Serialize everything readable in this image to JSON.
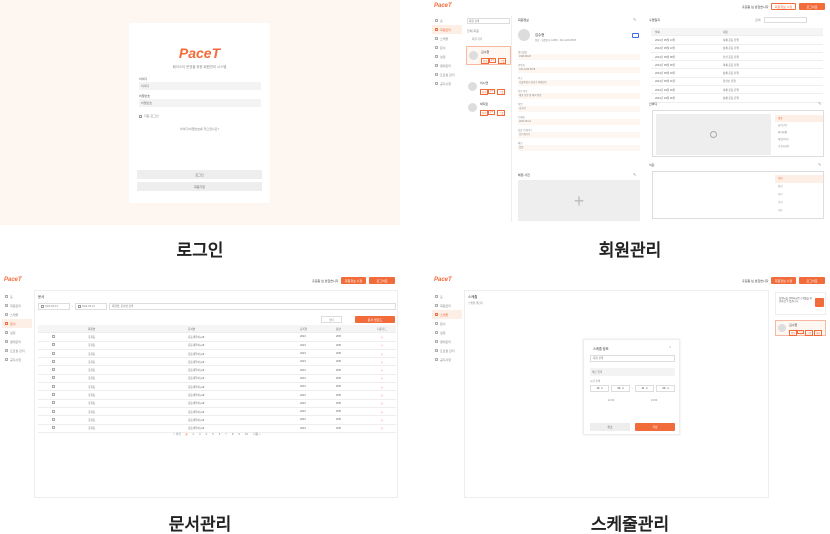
{
  "captions": {
    "login": "로그인",
    "member": "회원관리",
    "document": "문서관리",
    "schedule": "스케줄관리"
  },
  "brand": "PaceT",
  "colors": {
    "accent": "#f26b3a",
    "login_bg": "#fdf6f1",
    "field_bg": "#f3f3f3"
  },
  "login": {
    "subtitle": "페이스티 운영을 위한 회원관리 시스템",
    "id_label": "아이디",
    "id_placeholder": "아이디",
    "pw_label": "비밀번호",
    "pw_placeholder": "비밀번호",
    "remember_label": "자동 로그인",
    "find_link": "아이디/비밀번호를 잊으셨나요?",
    "login_button": "로그인",
    "signup_button": "회원가입"
  },
  "header": {
    "user_label": "홍길동 님 반갑습니다",
    "mypage_button": "회원정보 수정",
    "logout_button": "로그아웃"
  },
  "sidebar": {
    "items": [
      "홈",
      "회원관리",
      "스케줄",
      "문서",
      "설정",
      "결제관리",
      "프로필 관리",
      "공지사항"
    ]
  },
  "member": {
    "search_placeholder": "회원 검색",
    "list_header": "회원 목록",
    "group_label": "전체 회원",
    "members": [
      {
        "name": "김수현",
        "tags": [
          "정상",
          "PT",
          "그룹"
        ]
      },
      {
        "name": "이시연",
        "tags": [
          "정상",
          "PT",
          "그룹"
        ]
      },
      {
        "name": "박지민",
        "tags": [
          "정상",
          "PT",
          "그룹"
        ]
      }
    ],
    "detail_title": "회원정보",
    "profile_name": "김수현",
    "profile_sub": "정상 · 회원번호 12345 · 010-1234-5678",
    "fields": [
      {
        "label": "생년월일",
        "value": "1999.08.20"
      },
      {
        "label": "연락처",
        "value": "010-1234-5678"
      },
      {
        "label": "주소",
        "value": "서울특별시 강남구 테헤란로"
      },
      {
        "label": "운동 목표",
        "value": "체중 감량 및 체력 향상"
      },
      {
        "label": "직업",
        "value": "회사원"
      },
      {
        "label": "등록일",
        "value": "2023.05.12"
      },
      {
        "label": "담당 트레이너",
        "value": "김트레이너"
      },
      {
        "label": "메모",
        "value": "없음"
      }
    ],
    "photo_title": "체형 사진",
    "log_title": "수업일지",
    "log_search": "검색",
    "log_headers": [
      "날짜",
      "내용"
    ],
    "log_rows": [
      [
        "2024년 05월 13일",
        "하체 운동 진행"
      ],
      [
        "2024년 05월 10일",
        "상체 운동 진행"
      ],
      [
        "2024년 05월 08일",
        "전신 운동 진행"
      ],
      [
        "2024년 05월 06일",
        "하체 운동 진행"
      ],
      [
        "2024년 05월 03일",
        "상체 운동 진행"
      ],
      [
        "2024년 05월 01일",
        "유산소 진행"
      ],
      [
        "2024년 04월 29일",
        "하체 운동 진행"
      ],
      [
        "2024년 04월 26일",
        "상체 운동 진행"
      ]
    ],
    "inbody_title": "인바디",
    "inbody_menu": [
      "체중",
      "골격근량",
      "체지방률",
      "체질량지수",
      "기초대사량"
    ],
    "diet_title": "식단",
    "diet_menu": [
      "아침",
      "점심",
      "저녁",
      "간식",
      "기타"
    ]
  },
  "document": {
    "title": "문서",
    "date_from": "2024-05-14",
    "date_to": "2024-05-13",
    "search_placeholder": "회원명, 문서명 검색",
    "filter_button": "필터",
    "upload_button": "문서 업로드",
    "headers": [
      "회원명",
      "문서명",
      "등록일",
      "용량",
      "다운로드"
    ],
    "rows": [
      [
        "홍길동",
        "운동계약서.pdf",
        "2024",
        "2KB"
      ],
      [
        "홍길동",
        "운동계약서.pdf",
        "2024",
        "2KB"
      ],
      [
        "홍길동",
        "운동계약서.pdf",
        "2024",
        "2KB"
      ],
      [
        "홍길동",
        "운동계약서.pdf",
        "2024",
        "2KB"
      ],
      [
        "홍길동",
        "운동계약서.pdf",
        "2024",
        "2KB"
      ],
      [
        "홍길동",
        "운동계약서.pdf",
        "2024",
        "2KB"
      ],
      [
        "홍길동",
        "운동계약서.pdf",
        "2024",
        "2KB"
      ],
      [
        "홍길동",
        "운동계약서.pdf",
        "2024",
        "2KB"
      ],
      [
        "홍길동",
        "운동계약서.pdf",
        "2024",
        "2KB"
      ],
      [
        "홍길동",
        "운동계약서.pdf",
        "2024",
        "2KB"
      ],
      [
        "홍길동",
        "운동계약서.pdf",
        "2024",
        "2KB"
      ],
      [
        "홍길동",
        "운동계약서.pdf",
        "2024",
        "2KB"
      ]
    ],
    "pages": [
      "< 이전",
      "1",
      "2",
      "3",
      "4",
      "5",
      "6",
      "7",
      "8",
      "9",
      "10",
      "다음 >"
    ]
  },
  "schedule": {
    "title": "스케줄",
    "calendar_label": "스케줄 캘린더",
    "modal_title": "스케줄 정보",
    "member_placeholder": "회원 선택",
    "memo_placeholder": "메모 입력",
    "time_label": "시간 선택",
    "time_values": [
      "10",
      "00",
      "11",
      "00"
    ],
    "start_time": "12:00",
    "end_time": "13:00",
    "cancel_button": "취소",
    "save_button": "저장",
    "notice_text": "회원님을 선택하시면 스케줄을 확인하실 수 있습니다.",
    "member_name": "김수현",
    "member_tags": [
      "정상",
      "PT",
      "그룹",
      "개인"
    ]
  }
}
